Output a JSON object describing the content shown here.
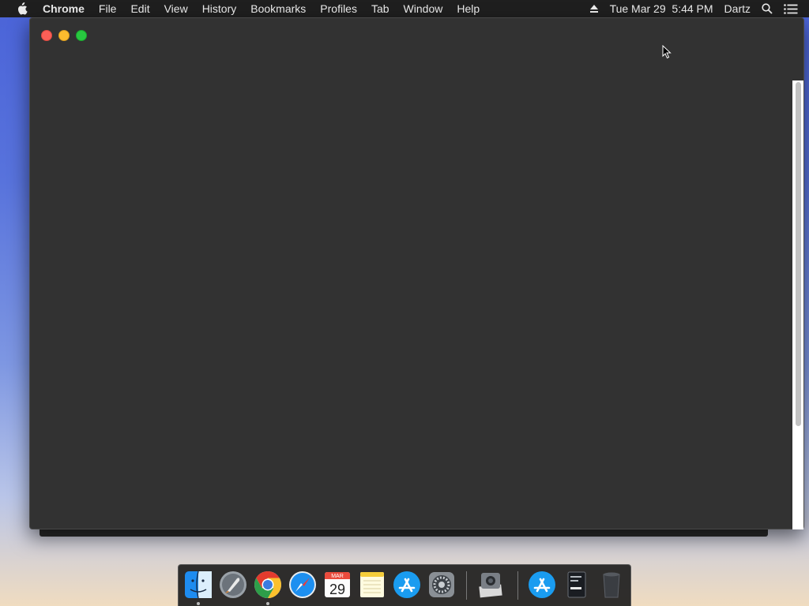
{
  "menubar": {
    "app_name": "Chrome",
    "items": [
      "File",
      "Edit",
      "View",
      "History",
      "Bookmarks",
      "Profiles",
      "Tab",
      "Window",
      "Help"
    ],
    "datetime": "Tue Mar 29  5:44 PM",
    "user": "Dartz"
  },
  "dock": {
    "calendar_month": "MAR",
    "calendar_day": "29",
    "items": [
      "finder",
      "launchpad",
      "chrome",
      "safari",
      "calendar",
      "notes",
      "app-store",
      "system-preferences",
      "image-capture",
      "app-store",
      "ebook",
      "trash"
    ]
  },
  "colors": {
    "menubar_bg": "#1f1f1f",
    "window_bg": "#323232",
    "close": "#fc5f57",
    "minimize": "#fdbc2e",
    "maximize": "#28c840"
  }
}
